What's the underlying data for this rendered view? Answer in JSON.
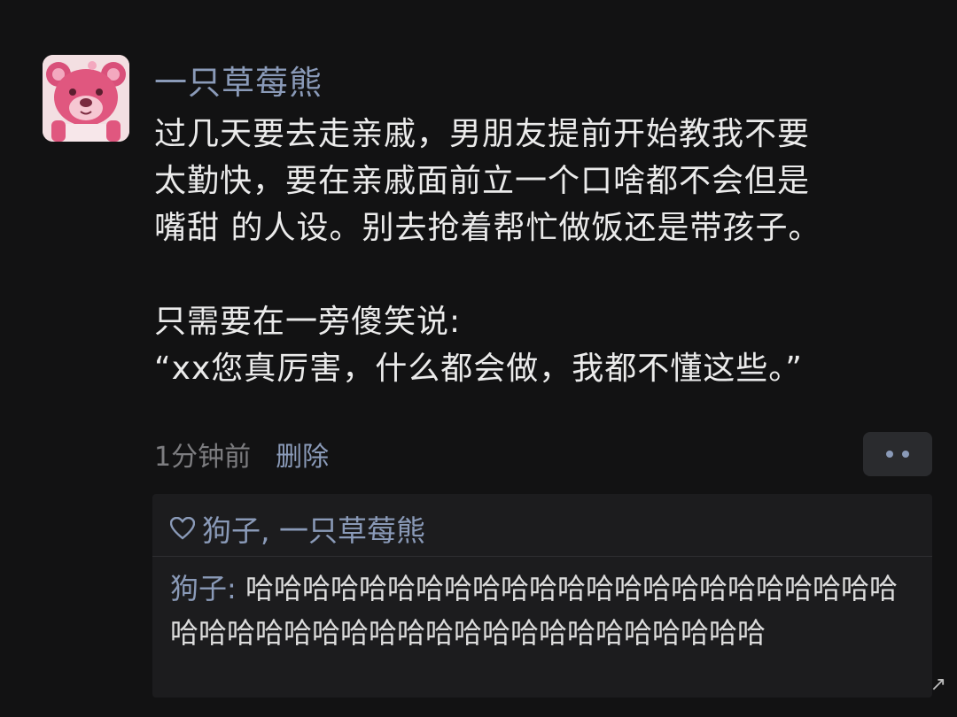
{
  "post": {
    "avatar_icon": "strawberry-bear-avatar",
    "nickname": "一只草莓熊",
    "body_lines": [
      "过几天要去走亲戚，男朋友提前开始教我不要",
      "太勤快，要在亲戚面前立一个口啥都不会但是",
      "嘴甜 的人设。别去抢着帮忙做饭还是带孩子。",
      "只需要在一旁傻笑说:",
      "“xx您真厉害，什么都会做，我都不懂这些。”"
    ],
    "time": "1分钟前",
    "delete_label": "删除",
    "more_icon": "more-dots-icon"
  },
  "interactions": {
    "like_icon": "heart-icon",
    "likers": "狗子, 一只草莓熊",
    "comment": {
      "author": "狗子",
      "separator": ": ",
      "text": "哈哈哈哈哈哈哈哈哈哈哈哈哈哈哈哈哈哈哈哈哈哈哈哈哈哈哈哈哈哈哈哈哈哈哈哈哈哈哈哈哈哈哈哈"
    }
  },
  "colors": {
    "background": "#121213",
    "link": "#8a9ab8",
    "text": "#ebebeb",
    "muted": "#7d7d80",
    "card": "#1c1c1e"
  }
}
